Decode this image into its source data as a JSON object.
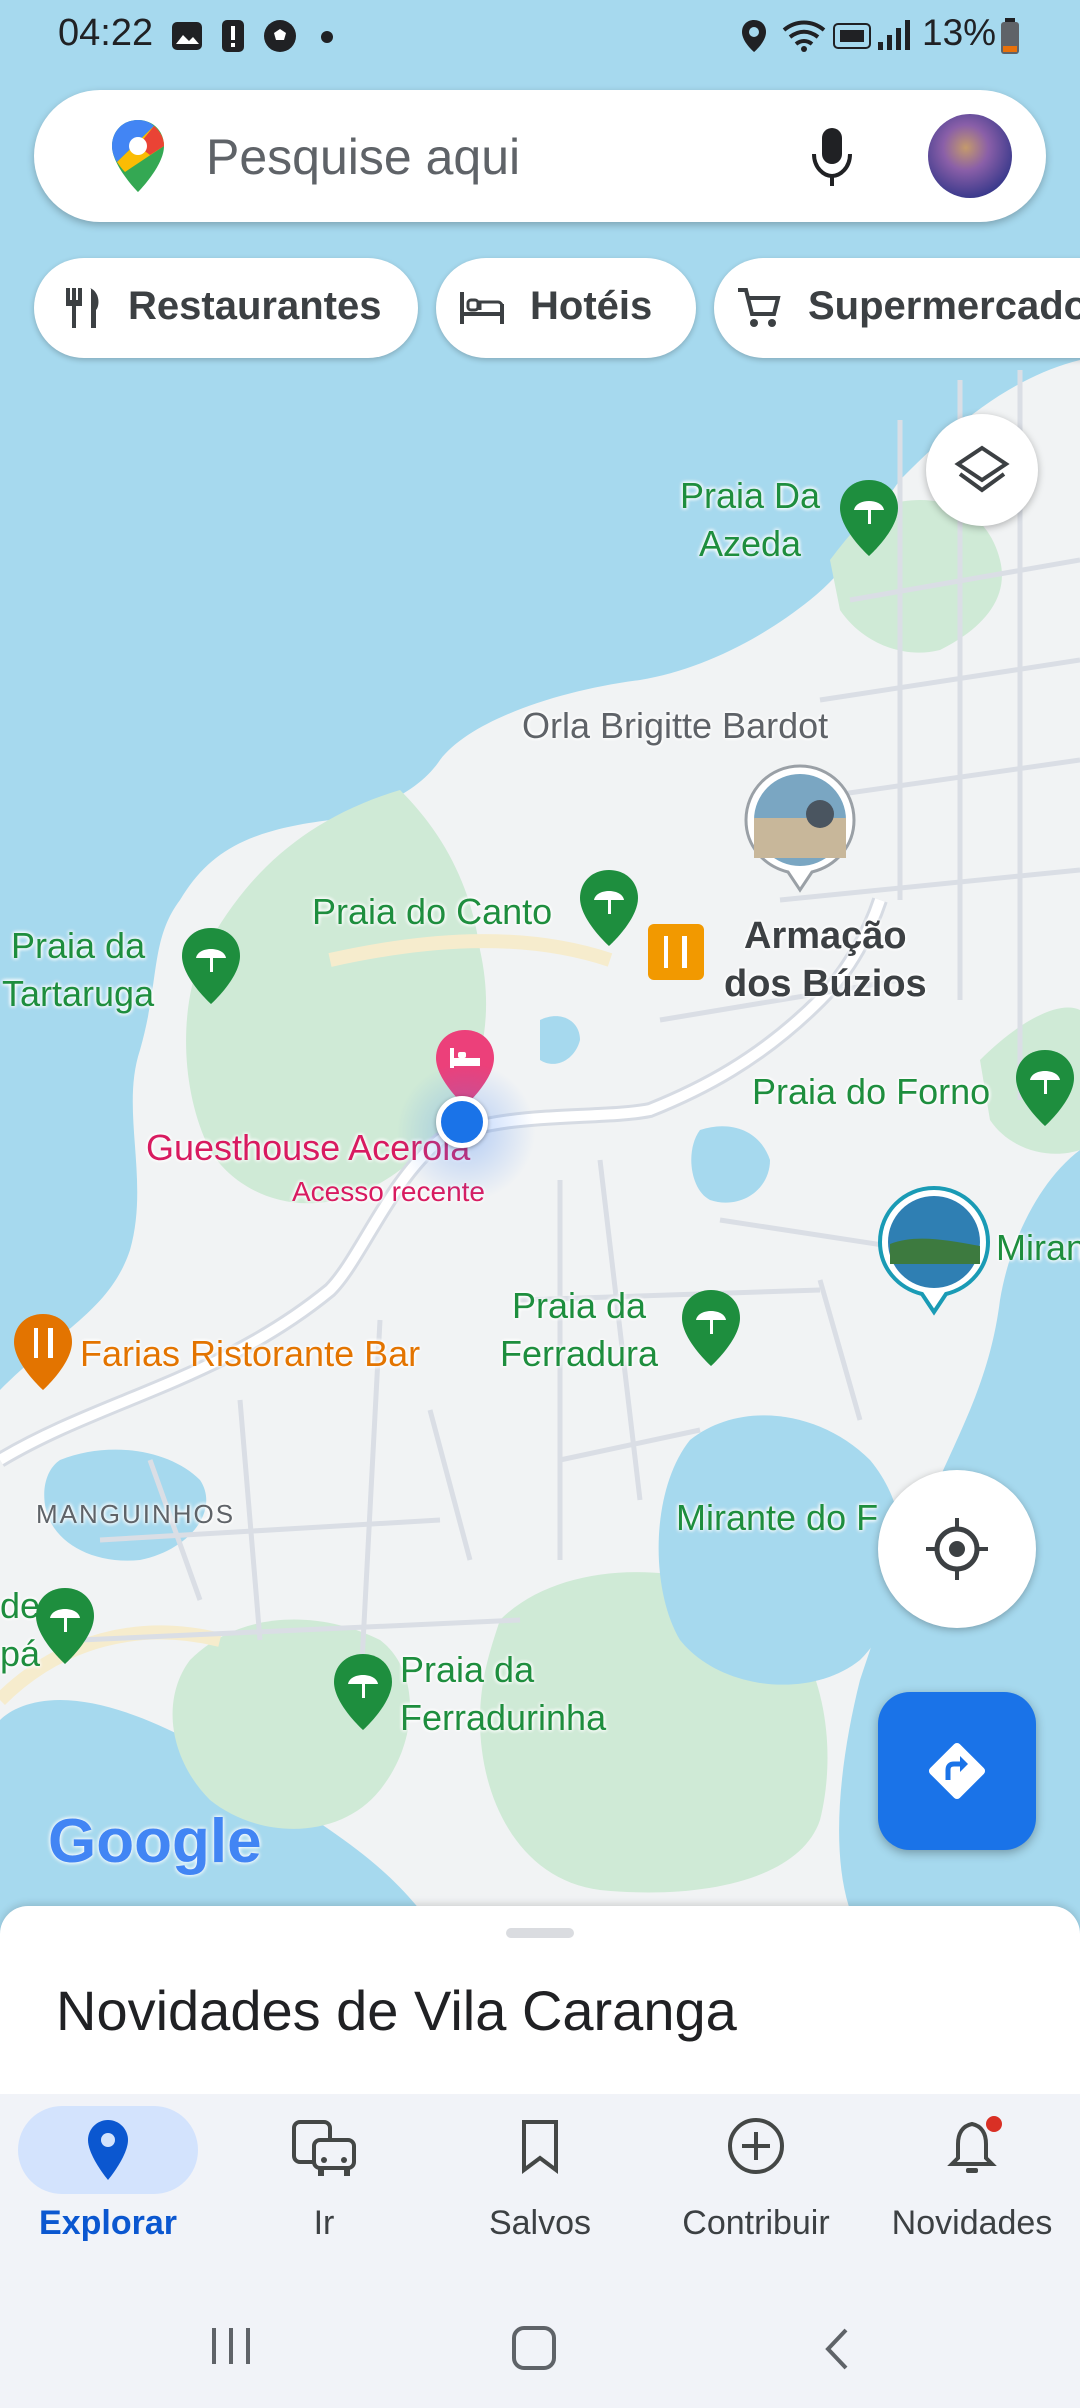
{
  "status_bar": {
    "time": "04:22",
    "battery": "13%"
  },
  "search": {
    "placeholder": "Pesquise aqui"
  },
  "chips": [
    {
      "label": "Restaurantes",
      "icon": "fork-knife-icon"
    },
    {
      "label": "Hotéis",
      "icon": "bed-icon"
    },
    {
      "label": "Supermercado",
      "icon": "cart-icon"
    }
  ],
  "map": {
    "labels": {
      "praia_da_azeda": "Praia Da\nAzeda",
      "orla_brigitte_bardot": "Orla Brigitte Bardot",
      "praia_do_canto": "Praia do Canto",
      "armacao_dos_buzios": "Armação\ndos Búzios",
      "praia_da_tartaruga": "Praia da\nTartaruga",
      "praia_do_forno": "Praia do Forno",
      "guesthouse_acerola": "Guesthouse Acerola",
      "acesso_recente": "Acesso recente",
      "mirante_right": "Miran",
      "praia_da_ferradura": "Praia da\nFerradura",
      "farias_ristorante_bar": "Farias Ristorante Bar",
      "manguinhos": "MANGUINHOS",
      "mirante_do": "Mirante do F",
      "left_edge": "de\npá",
      "praia_da_ferradurinha": "Praia da\nFerradurinha",
      "google_logo": "Google"
    }
  },
  "sheet": {
    "title": "Novidades de Vila Caranga"
  },
  "bottom_nav": [
    {
      "label": "Explorar",
      "icon": "location-pin-icon",
      "active": true
    },
    {
      "label": "Ir",
      "icon": "commute-icon",
      "active": false
    },
    {
      "label": "Salvos",
      "icon": "bookmark-icon",
      "active": false
    },
    {
      "label": "Contribuir",
      "icon": "add-circle-icon",
      "active": false
    },
    {
      "label": "Novidades",
      "icon": "bell-icon",
      "active": false
    }
  ],
  "colors": {
    "water": "#a6d9ee",
    "land": "#f1f3f4",
    "park": "#cfead6",
    "accent_blue": "#1a73e8",
    "beach_green": "#1e8e3e",
    "hotel_pink": "#d81b60",
    "restaurant_orange": "#e37400"
  }
}
